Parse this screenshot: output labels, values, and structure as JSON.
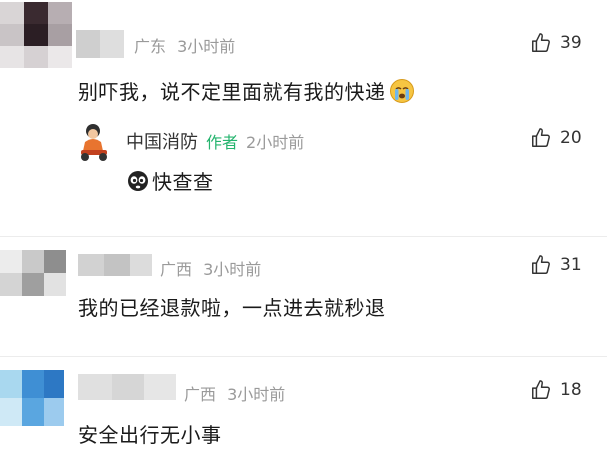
{
  "comments": [
    {
      "location": "广东",
      "time": "3小时前",
      "likes": "39",
      "text": "别吓我，说不定里面就有我的快递",
      "emoji": "crying-face",
      "reply": {
        "name": "中国消防",
        "author_tag": "作者",
        "time": "2小时前",
        "likes": "20",
        "text": "快查查",
        "emoji": "panda-face"
      }
    },
    {
      "location": "广西",
      "time": "3小时前",
      "likes": "31",
      "text": "我的已经退款啦，一点进去就秒退"
    },
    {
      "location": "广西",
      "time": "3小时前",
      "likes": "18",
      "text": "安全出行无小事"
    }
  ],
  "colors": {
    "author_tag": "#25b46e",
    "meta_gray": "#9a9a9a"
  },
  "icons": [
    "thumbs-up-icon",
    "crying-face-emoji",
    "panda-face-emoji",
    "firefighter-avatar"
  ]
}
